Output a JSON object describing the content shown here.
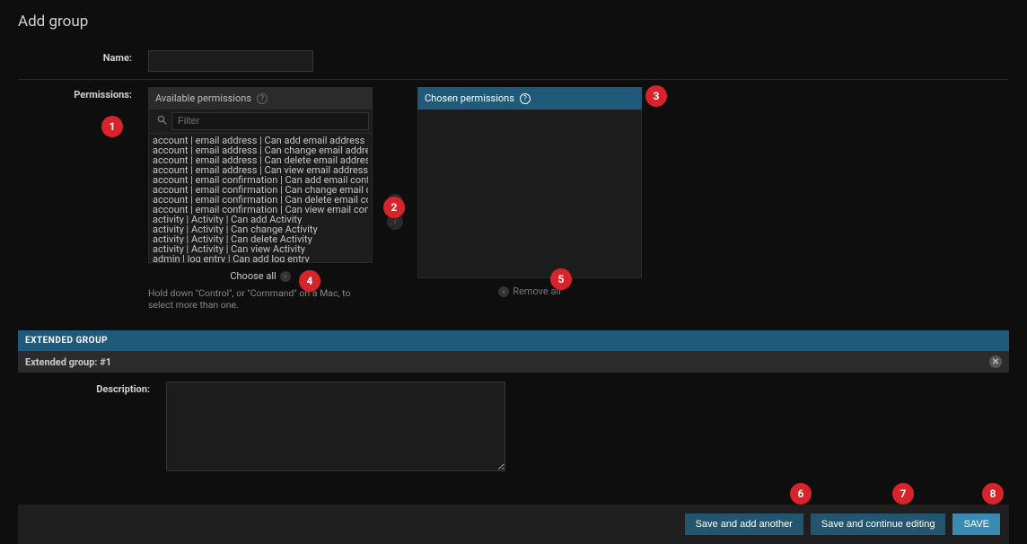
{
  "page_title": "Add group",
  "labels": {
    "name": "Name:",
    "permissions": "Permissions:",
    "description": "Description:"
  },
  "available": {
    "header": "Available permissions",
    "filter_placeholder": "Filter",
    "items": [
      "account | email address | Can add email address",
      "account | email address | Can change email address",
      "account | email address | Can delete email address",
      "account | email address | Can view email address",
      "account | email confirmation | Can add email confirmation",
      "account | email confirmation | Can change email confirmation",
      "account | email confirmation | Can delete email confirmation",
      "account | email confirmation | Can view email confirmation",
      "activity | Activity | Can add Activity",
      "activity | Activity | Can change Activity",
      "activity | Activity | Can delete Activity",
      "activity | Activity | Can view Activity",
      "admin | log entry | Can add log entry"
    ]
  },
  "chosen": {
    "header": "Chosen permissions"
  },
  "links": {
    "choose_all": "Choose all",
    "remove_all": "Remove all"
  },
  "hint": "Hold down \"Control\", or \"Command\" on a Mac, to select more than one.",
  "extended": {
    "header": "EXTENDED GROUP",
    "sub": "Extended group: #1"
  },
  "buttons": {
    "save_add_another": "Save and add another",
    "save_continue": "Save and continue editing",
    "save": "SAVE"
  },
  "badges": [
    "1",
    "2",
    "3",
    "4",
    "5",
    "6",
    "7",
    "8"
  ]
}
